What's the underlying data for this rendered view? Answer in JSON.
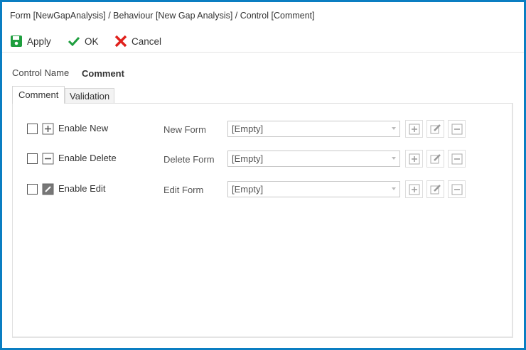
{
  "title": "Form [NewGapAnalysis] / Behaviour [New Gap Analysis] / Control [Comment]",
  "toolbar": {
    "apply": "Apply",
    "ok": "OK",
    "cancel": "Cancel"
  },
  "control_name": {
    "label": "Control Name",
    "value": "Comment"
  },
  "tabs": [
    {
      "label": "Comment",
      "active": true
    },
    {
      "label": "Validation",
      "active": false
    }
  ],
  "rows": [
    {
      "label": "Enable New",
      "form_label": "New Form",
      "value": "[Empty]",
      "icon": "plus-icon",
      "checked": false
    },
    {
      "label": "Enable Delete",
      "form_label": "Delete Form",
      "value": "[Empty]",
      "icon": "minus-icon",
      "checked": false
    },
    {
      "label": "Enable Edit",
      "form_label": "Edit Form",
      "value": "[Empty]",
      "icon": "edit-icon",
      "checked": false
    }
  ],
  "colors": {
    "border": "#0a7ec2",
    "apply": "#1e9e3e",
    "ok": "#1e9e3e",
    "cancel": "#e0201c"
  }
}
